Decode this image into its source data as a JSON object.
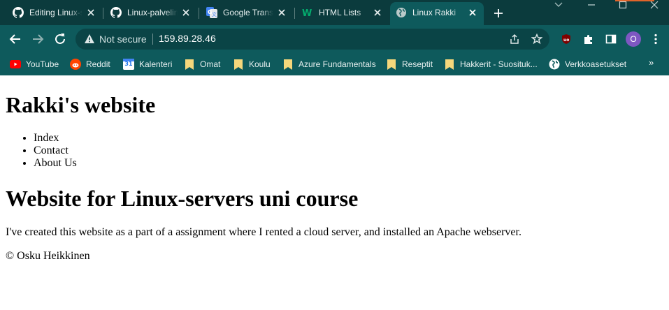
{
  "browser": {
    "tabs": [
      {
        "title": "Editing Linux-servers",
        "icon": "github-icon"
      },
      {
        "title": "Linux-palvelimet",
        "icon": "github-icon"
      },
      {
        "title": "Google Translate",
        "icon": "google-translate-icon"
      },
      {
        "title": "HTML Lists",
        "icon": "w3schools-icon"
      },
      {
        "title": "Linux Rakki",
        "icon": "globe-icon",
        "active": true
      }
    ],
    "address_bar": {
      "security_label": "Not secure",
      "url": "159.89.28.46"
    },
    "profile_initial": "O",
    "bookmarks": [
      {
        "label": "YouTube",
        "icon": "youtube-icon"
      },
      {
        "label": "Reddit",
        "icon": "reddit-icon"
      },
      {
        "label": "Kalenteri",
        "icon": "calendar-icon",
        "badge": "31"
      },
      {
        "label": "Omat",
        "icon": "folder-icon"
      },
      {
        "label": "Koulu",
        "icon": "folder-icon"
      },
      {
        "label": "Azure Fundamentals",
        "icon": "folder-icon"
      },
      {
        "label": "Reseptit",
        "icon": "folder-icon"
      },
      {
        "label": "Hakkerit - Suosituk...",
        "icon": "folder-icon"
      },
      {
        "label": "Verkkoasetukset",
        "icon": "globe-icon"
      }
    ],
    "bookmarks_overflow": "»",
    "colors": {
      "frame": "#0b3b3d",
      "toolbar": "#0e5a5c",
      "omnibox": "#0a4446",
      "profile": "#7e57c2"
    }
  },
  "page": {
    "title": "Rakki's website",
    "nav": [
      "Index",
      "Contact",
      "About Us"
    ],
    "heading": "Website for Linux-servers uni course",
    "paragraph": "I've created this website as a part of a assignment where I rented a cloud server, and installed an Apache webserver.",
    "footer": "© Osku Heikkinen"
  }
}
